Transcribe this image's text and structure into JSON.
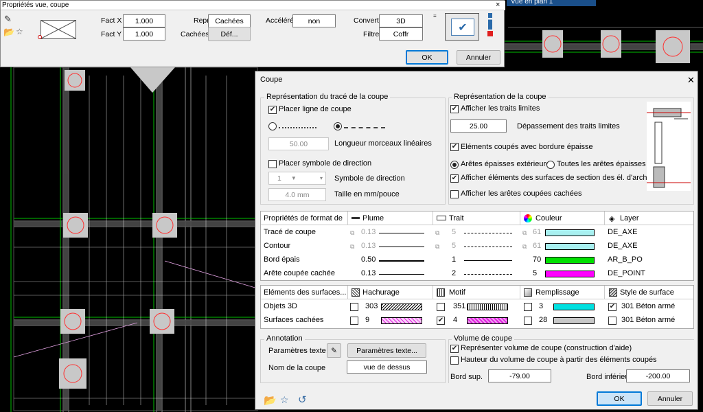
{
  "top": {
    "title": "Propriétés vue, coupe",
    "fact_x_label": "Fact X",
    "fact_x": "1.000",
    "fact_y_label": "Fact Y",
    "fact_y": "1.000",
    "repr_label": "Repr",
    "repr_value": "Cachées",
    "cachees_label": "Cachées",
    "def_button": "Déf...",
    "accelere_label": "Accéléré",
    "accelere_value": "non",
    "converti_label": "Converti",
    "converti_value": "3D",
    "filtre_label": "Filtre",
    "filtre_value": "Coffr",
    "ok": "OK",
    "annuler": "Annuler",
    "close_glyph": "×"
  },
  "background_window_title": "Vue en plan 1",
  "coupe": {
    "title": "Coupe",
    "close_glyph": "✕",
    "trace_group": "Représentation du tracé de la coupe",
    "placer_ligne": "Placer ligne de coupe",
    "longueur_value": "50.00",
    "longueur_label": "Longueur morceaux linéaires",
    "placer_symbole": "Placer symbole de direction",
    "symbole_value": "1",
    "symbole_label": "Symbole de direction",
    "taille_value": "4.0 mm",
    "taille_label": "Taille en mm/pouce",
    "repr_group": "Représentation de la coupe",
    "afficher_traits": "Afficher les traits limites",
    "depassement_value": "25.00",
    "depassement_label": "Dépassement des traits limites",
    "elements_bordure": "Eléments coupés avec bordure épaisse",
    "aretes_ext": "Arêtes épaisses extérieure",
    "toutes_aretes": "Toutes les arêtes épaisses",
    "afficher_elements": "Afficher éléments des surfaces de section des él. d'archit.",
    "afficher_cachees": "Afficher les arêtes coupées cachées",
    "format_table": {
      "headers": [
        "Propriétés de format de",
        "Plume",
        "Trait",
        "Couleur",
        "Layer"
      ],
      "rows": [
        {
          "name": "Tracé de coupe",
          "plume": "0.13",
          "trait": "5",
          "couleur": "61",
          "color": "#a8f0f0",
          "layer": "DE_AXE",
          "dim": true
        },
        {
          "name": "Contour",
          "plume": "0.13",
          "trait": "5",
          "couleur": "61",
          "color": "#a8f0f0",
          "layer": "DE_AXE",
          "dim": true
        },
        {
          "name": "Bord épais",
          "plume": "0.50",
          "trait": "1",
          "couleur": "70",
          "color": "#00e000",
          "layer": "AR_B_PO",
          "dim": false
        },
        {
          "name": "Arête coupée cachée",
          "plume": "0.13",
          "trait": "2",
          "couleur": "5",
          "color": "#ff00ff",
          "layer": "DE_POINT",
          "dim": false
        }
      ]
    },
    "surf_table": {
      "headers": [
        "Eléments des surfaces...",
        "Hachurage",
        "Motif",
        "Remplissage",
        "Style de surface"
      ],
      "rows": [
        {
          "name": "Objets 3D",
          "hach": "303",
          "motif": "351",
          "rempl": "3",
          "rempl_color": "#00e0e0",
          "style": "301 Béton armé",
          "style_on": true,
          "motif_on": false
        },
        {
          "name": "Surfaces cachées",
          "hach": "9",
          "motif": "4",
          "rempl": "28",
          "rempl_color": "#c8c8c8",
          "style": "301 Béton armé",
          "style_on": false,
          "motif_on": true
        }
      ]
    },
    "annotation_group": "Annotation",
    "param_texte_label": "Paramètres texte",
    "param_texte_button": "Paramètres texte...",
    "nom_coupe_label": "Nom de la coupe",
    "nom_coupe_value": "vue de dessus",
    "volume_group": "Volume de coupe",
    "representer_volume": "Représenter volume de coupe (construction d'aide)",
    "hauteur_volume": "Hauteur du volume de coupe à partir des éléments coupés",
    "bord_sup_label": "Bord sup.",
    "bord_sup_value": "-79.00",
    "bord_inf_label": "Bord inférieur",
    "bord_inf_value": "-200.00",
    "ok": "OK",
    "annuler": "Annuler"
  },
  "colors": {
    "accent": "#0078d7",
    "dialog_bg": "#f0f0f0",
    "cad_bg": "#000000"
  }
}
